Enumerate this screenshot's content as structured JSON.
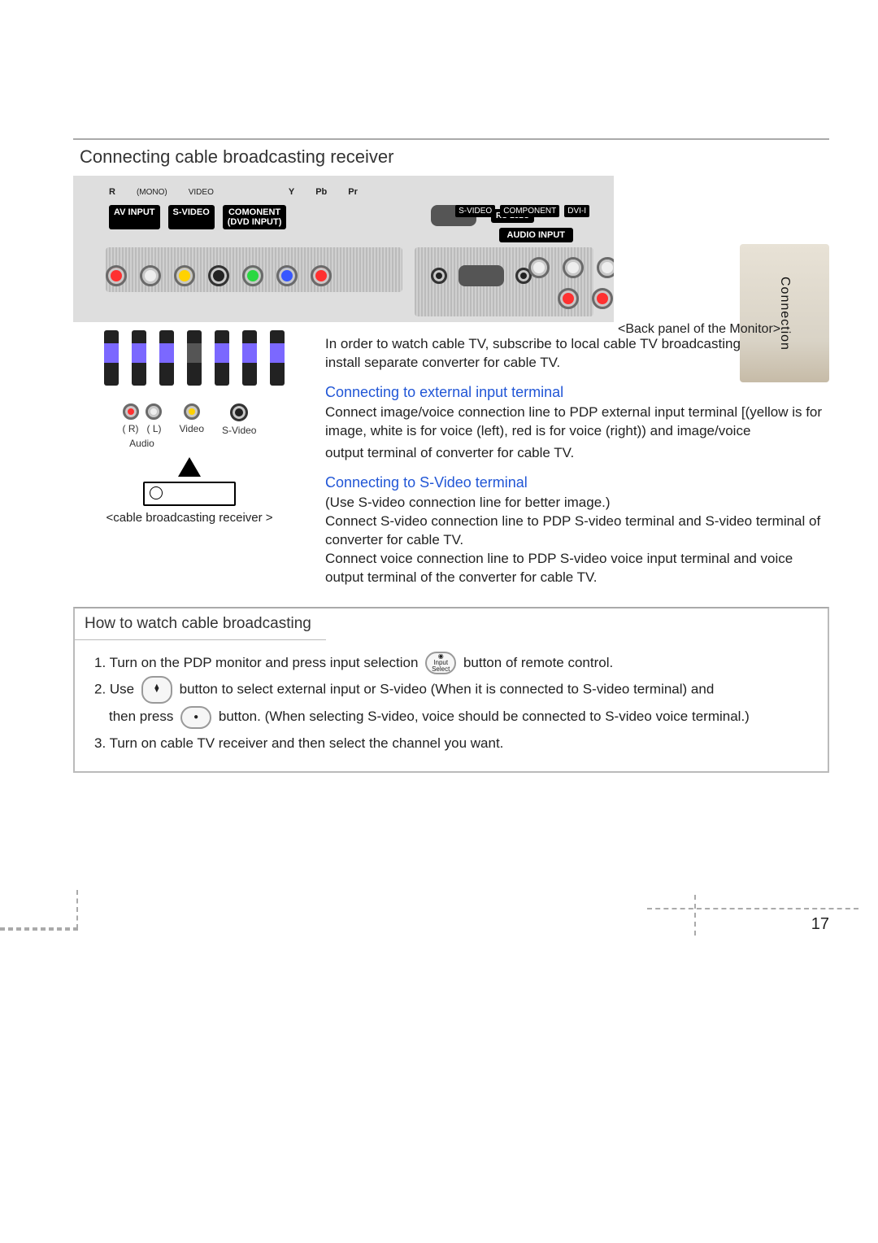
{
  "side_tab": "Connection",
  "page_number": "17",
  "section1": {
    "title": "Connecting cable broadcasting receiver",
    "back_panel_caption": "<Back panel of the Monitor>",
    "panel_top_labels": {
      "av_input": "AV INPUT",
      "s_video": "S-VIDEO",
      "component": "COMONENT\n(DVD INPUT)",
      "rs232": "RS-232C",
      "mini_svideo": "S-VIDEO",
      "mini_component": "COMPONENT",
      "mini_dvi": "DVI-I",
      "audio_input": "AUDIO INPUT",
      "audio_r": "R",
      "audio_mono": "(MONO)",
      "video_label": "VIDEO",
      "y": "Y",
      "pb": "Pb",
      "pr": "Pr"
    },
    "lower_diagram_caption": "<cable broadcasting receiver >",
    "lower_diagram_labels": {
      "r": "( R)",
      "l": "( L)",
      "audio": "Audio",
      "video": "Video",
      "svideo": "S-Video"
    },
    "intro_para": "In order to watch cable TV, subscribe to local cable TV broadcasting company and install separate converter for cable TV.",
    "sub1_title": "Connecting to external input terminal",
    "sub1_para1": "Connect image/voice connection line to PDP external input terminal [(yellow is for image, white is for voice (left), red is for voice (right)) and image/voice",
    "sub1_para2": "output terminal of converter for cable TV.",
    "sub2_title": "Connecting to S-Video terminal",
    "sub2_line1": "(Use S-video connection line for better image.)",
    "sub2_line2": "Connect S-video connection line to PDP S-video terminal and S-video terminal of converter for cable TV.",
    "sub2_line3": "Connect voice connection line to PDP S-video voice input terminal and voice output terminal of the converter for cable TV."
  },
  "section2": {
    "title": "How to watch cable broadcasting",
    "step1_a": "1. Turn on the PDP monitor and press input selection",
    "step1_b": "button of remote control.",
    "step1_icon_caption": "Input Select",
    "step2_a": "2. Use",
    "step2_b": "button to select external input or S-video (When it is connected to S-video terminal) and",
    "step2_c": "then press",
    "step2_d": "button. (When selecting S-video, voice should be connected to S-video voice terminal.)",
    "step3": "3. Turn on cable TV receiver and then select the channel you want."
  }
}
